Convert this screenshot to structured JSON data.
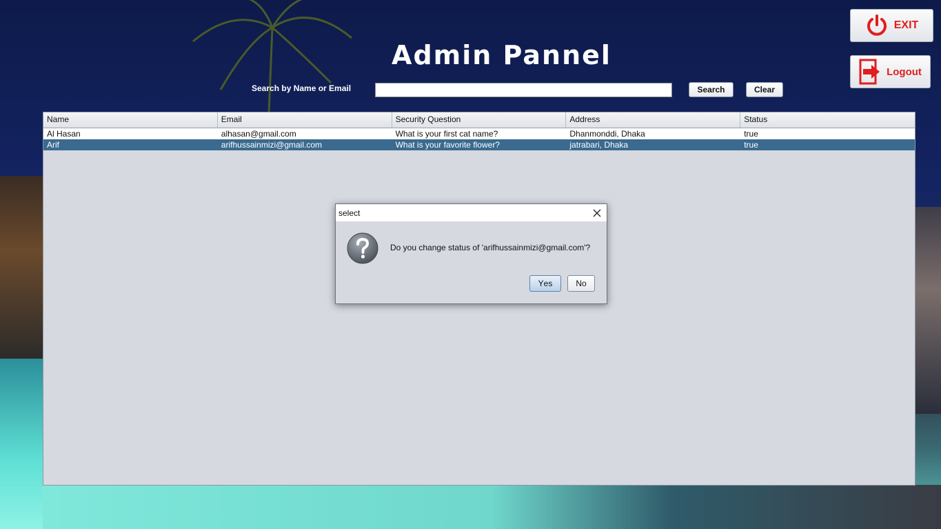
{
  "header": {
    "title": "Admin Pannel"
  },
  "search": {
    "label": "Search by Name or Email",
    "value": "",
    "search_button": "Search",
    "clear_button": "Clear"
  },
  "side_buttons": {
    "exit_label": "EXIT",
    "logout_label": "Logout"
  },
  "table": {
    "columns": [
      "Name",
      "Email",
      "Security Question",
      "Address",
      "Status"
    ],
    "rows": [
      [
        "Al Hasan",
        "alhasan@gmail.com",
        "What is your first cat name?",
        "Dhanmonddi, Dhaka",
        "true"
      ],
      [
        "Arif",
        "arifhussainmizi@gmail.com",
        "What is your favorite flower?",
        "jatrabari, Dhaka",
        "true"
      ]
    ],
    "selected_row": 1
  },
  "dialog": {
    "title": "select",
    "message": "Do you change status of 'arifhussainmizi@gmail.com'?",
    "yes_first": "Y",
    "yes_rest": "es",
    "no_first": "N",
    "no_rest": "o"
  },
  "colors": {
    "selected_row": "#3a6a8f",
    "accent_red": "#e01e1e"
  }
}
